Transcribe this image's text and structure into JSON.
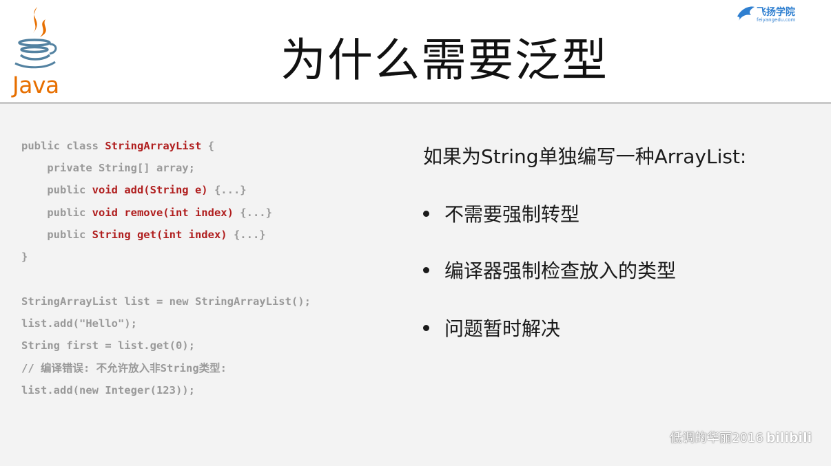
{
  "header": {
    "title": "为什么需要泛型",
    "logo_text": "Java",
    "brand_name": "飞扬学院",
    "brand_domain": "feiyangedu.com"
  },
  "code": {
    "block1": [
      {
        "parts": [
          {
            "t": "public class ",
            "hl": false
          },
          {
            "t": "StringArrayList",
            "hl": true
          },
          {
            "t": " {",
            "hl": false
          }
        ]
      },
      {
        "parts": [
          {
            "t": "    private String[] array;",
            "hl": false
          }
        ]
      },
      {
        "parts": [
          {
            "t": "    public ",
            "hl": false
          },
          {
            "t": "void add(String e)",
            "hl": true
          },
          {
            "t": " {...}",
            "hl": false
          }
        ]
      },
      {
        "parts": [
          {
            "t": "    public ",
            "hl": false
          },
          {
            "t": "void remove(int index)",
            "hl": true
          },
          {
            "t": " {...}",
            "hl": false
          }
        ]
      },
      {
        "parts": [
          {
            "t": "    public ",
            "hl": false
          },
          {
            "t": "String get(int index)",
            "hl": true
          },
          {
            "t": " {...}",
            "hl": false
          }
        ]
      },
      {
        "parts": [
          {
            "t": "}",
            "hl": false
          }
        ]
      }
    ],
    "block2": [
      "StringArrayList list = new StringArrayList();",
      "list.add(\"Hello\");",
      "String first = list.get(0);",
      "// 编译错误: 不允许放入非String类型:",
      "list.add(new Integer(123));"
    ]
  },
  "points": {
    "heading": "如果为String单独编写一种ArrayList:",
    "bullets": [
      "不需要强制转型",
      "编译器强制检查放入的类型",
      "问题暂时解决"
    ]
  },
  "watermark": {
    "author": "低调的华丽2016",
    "site": "bilibili"
  },
  "colors": {
    "java_orange": "#e76f00",
    "java_blue": "#5382a1",
    "code_highlight": "#b01e1e",
    "code_gray": "#999999",
    "brand_blue": "#2f7fd0"
  }
}
